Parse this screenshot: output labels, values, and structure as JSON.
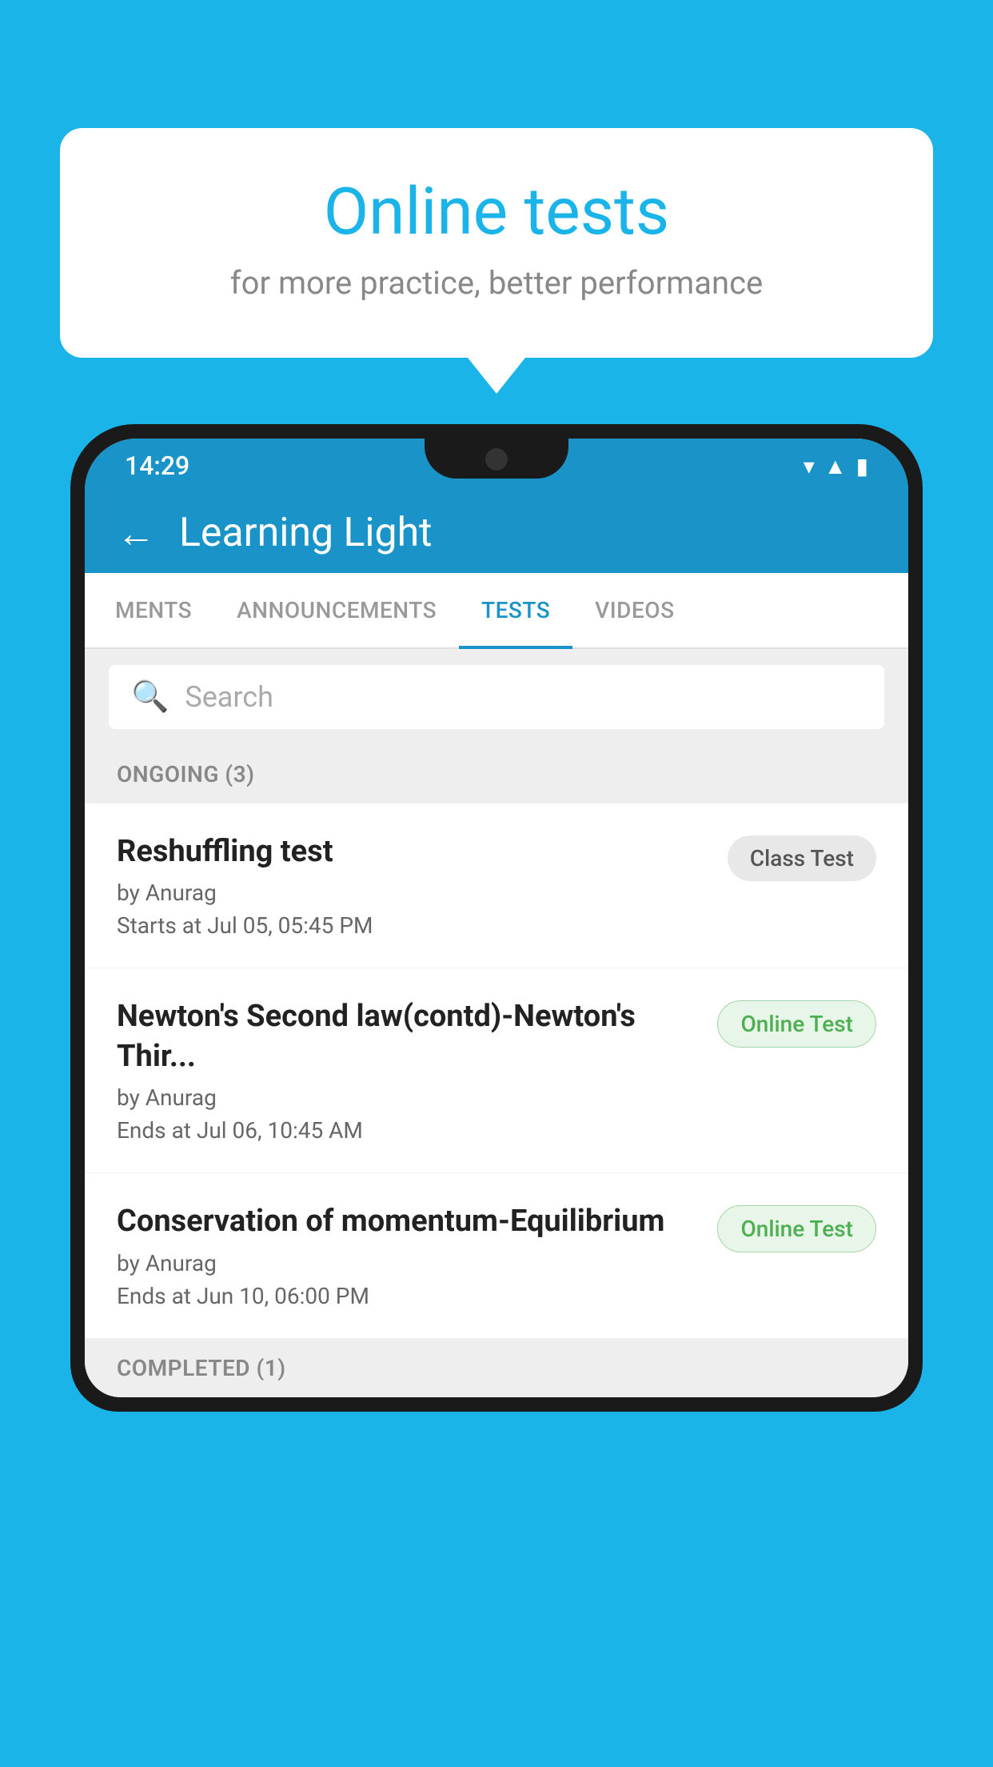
{
  "background": {
    "color": "#1ab4e8"
  },
  "bubble": {
    "title": "Online tests",
    "subtitle": "for more practice, better performance"
  },
  "status_bar": {
    "time": "14:29",
    "icons": [
      "wifi",
      "signal",
      "battery"
    ]
  },
  "app_header": {
    "title": "Learning Light",
    "back_label": "←"
  },
  "tabs": [
    {
      "label": "MENTS",
      "active": false
    },
    {
      "label": "ANNOUNCEMENTS",
      "active": false
    },
    {
      "label": "TESTS",
      "active": true
    },
    {
      "label": "VIDEOS",
      "active": false
    }
  ],
  "search": {
    "placeholder": "Search"
  },
  "ongoing_section": {
    "label": "ONGOING (3)"
  },
  "test_items": [
    {
      "name": "Reshuffling test",
      "author": "by Anurag",
      "date": "Starts at  Jul 05, 05:45 PM",
      "badge": "Class Test",
      "badge_type": "class"
    },
    {
      "name": "Newton's Second law(contd)-Newton's Thir...",
      "author": "by Anurag",
      "date": "Ends at  Jul 06, 10:45 AM",
      "badge": "Online Test",
      "badge_type": "online"
    },
    {
      "name": "Conservation of momentum-Equilibrium",
      "author": "by Anurag",
      "date": "Ends at  Jun 10, 06:00 PM",
      "badge": "Online Test",
      "badge_type": "online"
    }
  ],
  "completed_section": {
    "label": "COMPLETED (1)"
  }
}
